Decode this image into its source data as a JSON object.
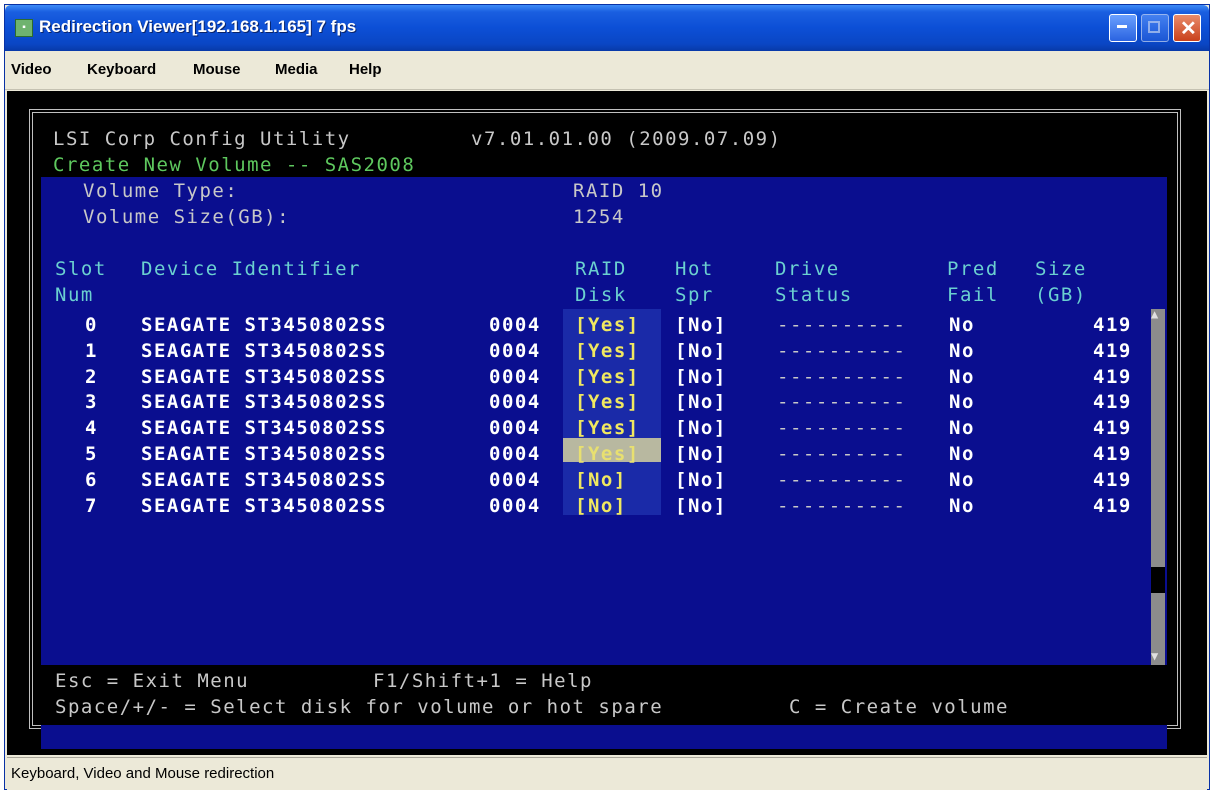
{
  "window": {
    "title": "Redirection Viewer[192.168.1.165]  7 fps",
    "icon": "app-icon"
  },
  "menu": [
    "Video",
    "Keyboard",
    "Mouse",
    "Media",
    "Help"
  ],
  "statusbar": {
    "text": "Keyboard, Video and Mouse redirection"
  },
  "bios": {
    "utility_name": "LSI Corp Config Utility",
    "version": "v7.01.01.00 (2009.07.09)",
    "subtitle": "Create New Volume -- SAS2008",
    "volume_type_label": "Volume Type:",
    "volume_type_value": "RAID 10",
    "volume_size_label": "Volume Size(GB):",
    "volume_size_value": "1254",
    "headers": {
      "slot_1": "Slot",
      "slot_2": "Num",
      "device": "Device Identifier",
      "raid_1": "RAID",
      "raid_2": "Disk",
      "hot_1": "Hot",
      "hot_2": "Spr",
      "drive_1": "Drive",
      "drive_2": "Status",
      "pred_1": "Pred",
      "pred_2": "Fail",
      "size_1": "Size",
      "size_2": "(GB)"
    },
    "rows": [
      {
        "slot": "0",
        "device": "SEAGATE ST3450802SS",
        "rev": "0004",
        "raid": "[Yes]",
        "hot": "[No]",
        "status": "----------",
        "pred": "No",
        "size": "419"
      },
      {
        "slot": "1",
        "device": "SEAGATE ST3450802SS",
        "rev": "0004",
        "raid": "[Yes]",
        "hot": "[No]",
        "status": "----------",
        "pred": "No",
        "size": "419"
      },
      {
        "slot": "2",
        "device": "SEAGATE ST3450802SS",
        "rev": "0004",
        "raid": "[Yes]",
        "hot": "[No]",
        "status": "----------",
        "pred": "No",
        "size": "419"
      },
      {
        "slot": "3",
        "device": "SEAGATE ST3450802SS",
        "rev": "0004",
        "raid": "[Yes]",
        "hot": "[No]",
        "status": "----------",
        "pred": "No",
        "size": "419"
      },
      {
        "slot": "4",
        "device": "SEAGATE ST3450802SS",
        "rev": "0004",
        "raid": "[Yes]",
        "hot": "[No]",
        "status": "----------",
        "pred": "No",
        "size": "419"
      },
      {
        "slot": "5",
        "device": "SEAGATE ST3450802SS",
        "rev": "0004",
        "raid": "[Yes]",
        "hot": "[No]",
        "status": "----------",
        "pred": "No",
        "size": "419"
      },
      {
        "slot": "6",
        "device": "SEAGATE ST3450802SS",
        "rev": "0004",
        "raid": "[No]",
        "hot": "[No]",
        "status": "----------",
        "pred": "No",
        "size": "419"
      },
      {
        "slot": "7",
        "device": "SEAGATE ST3450802SS",
        "rev": "0004",
        "raid": "[No]",
        "hot": "[No]",
        "status": "----------",
        "pred": "No",
        "size": "419"
      }
    ],
    "footer_line1_a": "Esc = Exit Menu",
    "footer_line1_b": "F1/Shift+1 = Help",
    "footer_line2_a": "Space/+/- = Select disk for volume or hot spare",
    "footer_line2_b": "C = Create volume",
    "colors": {
      "panel": "#0a0e8f",
      "selected_cell": "#b8b8a0",
      "highlight_text": "#f0e860",
      "header_text": "#6bd0d0"
    }
  }
}
